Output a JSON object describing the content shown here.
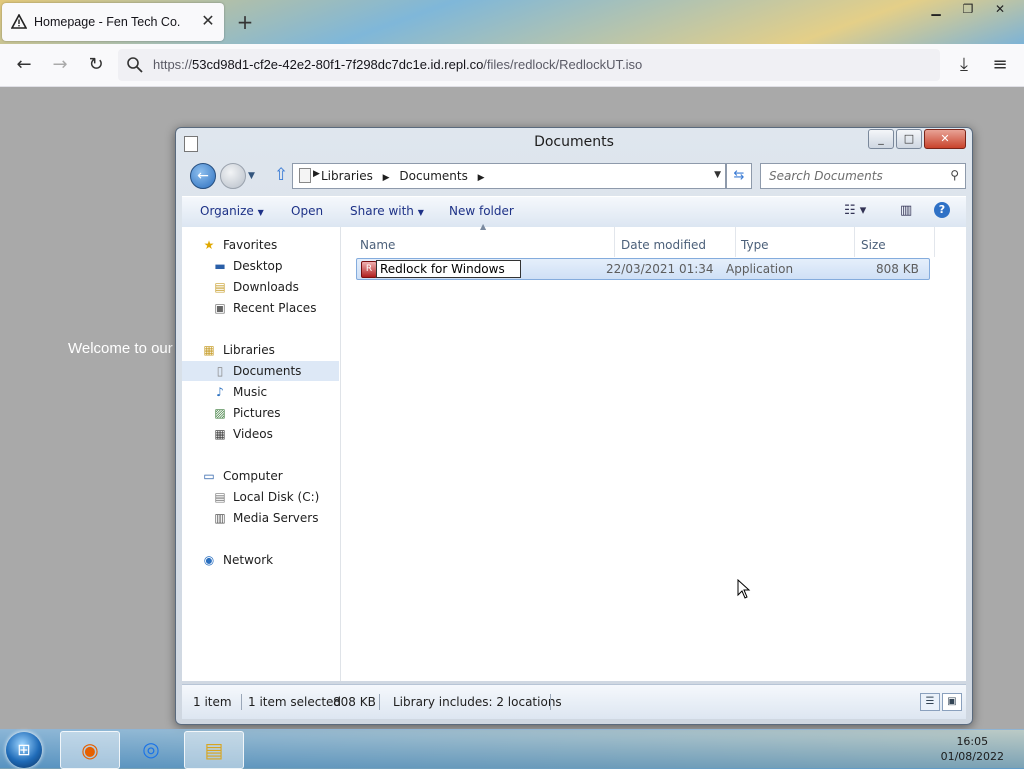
{
  "browser": {
    "tab_title": "Homepage - Fen Tech Co.",
    "url_prefix": "https://",
    "url_host": "53cd98d1-cf2e-42e2-80f1-7f298dc7dc1e.id.repl.co",
    "url_path": "/files/redlock/RedlockUT.iso",
    "page_text": "Welcome to our"
  },
  "explorer": {
    "title": "Documents",
    "breadcrumbs": [
      "Libraries",
      "Documents"
    ],
    "search_placeholder": "Search Documents",
    "toolbar": {
      "organize": "Organize",
      "open": "Open",
      "share_with": "Share with",
      "new_folder": "New folder"
    },
    "nav": {
      "favorites": "Favorites",
      "desktop": "Desktop",
      "downloads": "Downloads",
      "recent_places": "Recent Places",
      "libraries": "Libraries",
      "documents": "Documents",
      "music": "Music",
      "pictures": "Pictures",
      "videos": "Videos",
      "computer": "Computer",
      "local_disk": "Local Disk (C:)",
      "media_servers": "Media Servers",
      "network": "Network"
    },
    "columns": {
      "name": "Name",
      "date_modified": "Date modified",
      "type": "Type",
      "size": "Size"
    },
    "files": [
      {
        "name": "Redlock for Windows",
        "date_modified": "22/03/2021 01:34",
        "type": "Application",
        "size": "808 KB"
      }
    ],
    "status": {
      "count": "1 item",
      "selected": "1 item selected",
      "selected_size": "808 KB",
      "library": "Library includes: 2 locations"
    }
  },
  "taskbar": {
    "time": "16:05",
    "date": "01/08/2022"
  }
}
